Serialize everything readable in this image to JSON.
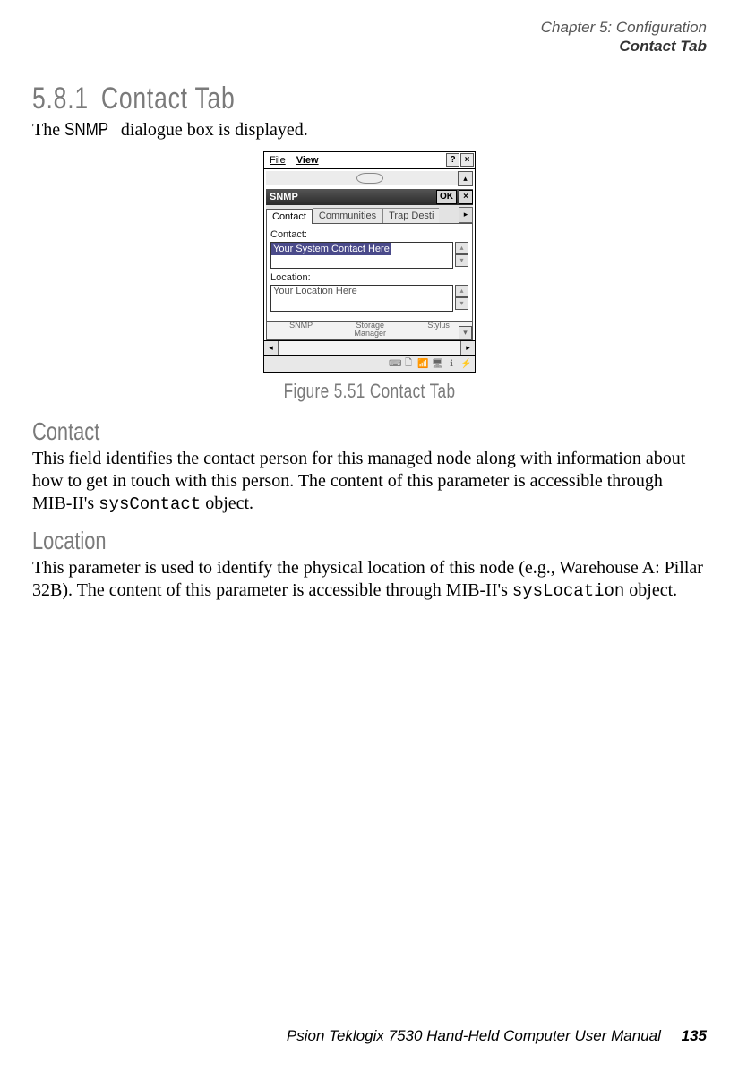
{
  "header": {
    "chapter": "Chapter 5: Configuration",
    "section": "Contact Tab"
  },
  "section": {
    "number": "5.8.1",
    "title": "Contact Tab"
  },
  "intro": {
    "pre": "The ",
    "snmp": "SNMP",
    "post": " dialogue box is displayed."
  },
  "shot": {
    "menu": {
      "file": "File",
      "view": "View",
      "help": "?",
      "close": "×"
    },
    "title": "SNMP",
    "ok": "OK",
    "x": "×",
    "tabs": {
      "contact": "Contact",
      "communities": "Communities",
      "trap": "Trap Desti",
      "arrow": "▸"
    },
    "contact_label": "Contact:",
    "contact_value": "Your System Contact Here",
    "location_label": "Location:",
    "location_value": "Your Location Here",
    "icons": {
      "a": "SNMP",
      "b_top": "Storage",
      "b_bot": "Manager",
      "c": "Stylus"
    },
    "scroll": {
      "up": "▴",
      "down": "▾",
      "left": "◂",
      "right": "▸"
    },
    "tray": {
      "a": "⌨",
      "b": "🗋",
      "c": "📶",
      "d": "🖥",
      "e": "ℹ",
      "f": "⚡"
    }
  },
  "figure": "Figure 5.51 Contact Tab",
  "contact": {
    "head": "Contact",
    "p1a": "This field identifies the contact person for this managed node along with information about how to get in touch with this person. The content of this parameter is accessible through MIB-II's ",
    "code": "sysContact",
    "p1b": " object."
  },
  "location": {
    "head": "Location",
    "p1a": "This parameter is used to identify the physical location of this node (e.g., Warehouse A: Pillar 32B). The content of this parameter is accessible through MIB-II's ",
    "code": "sysLocation",
    "p1b": " object."
  },
  "footer": {
    "text": "Psion Teklogix 7530 Hand-Held Computer User Manual",
    "page": "135"
  }
}
